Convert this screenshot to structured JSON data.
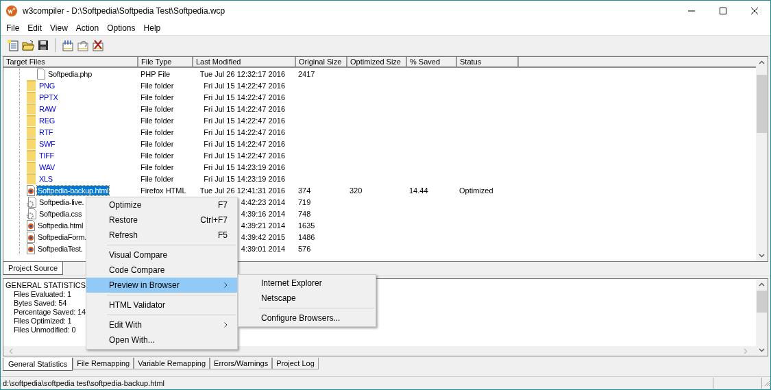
{
  "window": {
    "title": "w3compiler - D:\\Softpedia\\Softpedia Test\\Softpedia.wcp"
  },
  "menu_bar": [
    "File",
    "Edit",
    "View",
    "Action",
    "Options",
    "Help"
  ],
  "toolbar": [
    {
      "kind": "new"
    },
    {
      "kind": "open"
    },
    {
      "kind": "save"
    },
    {
      "kind": "separator"
    },
    {
      "kind": "optimize"
    },
    {
      "kind": "restore"
    },
    {
      "kind": "delete"
    }
  ],
  "file_list": {
    "columns": [
      "Target Files",
      "File Type",
      "Last Modified",
      "Original Size",
      "Optimized Size",
      "% Saved",
      "Status"
    ],
    "rows": [
      {
        "kind": "file",
        "name": "Softpedia.php",
        "type": "PHP File",
        "modified": "Tue Jul 26 12:32:17 2016",
        "original": "2417",
        "selected": false
      },
      {
        "kind": "folder",
        "name": "PNG",
        "type": "File folder",
        "modified": "Fri Jul 15 14:22:47 2016",
        "selected": false
      },
      {
        "kind": "folder",
        "name": "PPTX",
        "type": "File folder",
        "modified": "Fri Jul 15 14:22:47 2016",
        "selected": false
      },
      {
        "kind": "folder",
        "name": "RAW",
        "type": "File folder",
        "modified": "Fri Jul 15 14:22:47 2016",
        "selected": false
      },
      {
        "kind": "folder",
        "name": "REG",
        "type": "File folder",
        "modified": "Fri Jul 15 14:22:47 2016",
        "selected": false
      },
      {
        "kind": "folder",
        "name": "RTF",
        "type": "File folder",
        "modified": "Fri Jul 15 14:22:47 2016",
        "selected": false
      },
      {
        "kind": "folder",
        "name": "SWF",
        "type": "File folder",
        "modified": "Fri Jul 15 14:22:47 2016",
        "selected": false
      },
      {
        "kind": "folder",
        "name": "TIFF",
        "type": "File folder",
        "modified": "Fri Jul 15 14:22:47 2016",
        "selected": false
      },
      {
        "kind": "folder",
        "name": "WAV",
        "type": "File folder",
        "modified": "Fri Jul 15 14:23:19 2016",
        "selected": false
      },
      {
        "kind": "folder",
        "name": "XLS",
        "type": "File folder",
        "modified": "Fri Jul 15 14:23:19 2016",
        "selected": false
      },
      {
        "kind": "html",
        "name": "Softpedia-backup.html",
        "type": "Firefox HTML",
        "modified": "Tue Jul 26 12:41:31 2016",
        "original": "374",
        "optimized": "320",
        "saved": "14.44",
        "status": "Optimized",
        "selected": true
      },
      {
        "kind": "css",
        "name": "Softpedia-live.",
        "modified": "4:42:23 2014",
        "original": "719",
        "selected": false
      },
      {
        "kind": "css",
        "name": "Softpedia.css",
        "modified": "4:39:16 2014",
        "original": "748",
        "selected": false
      },
      {
        "kind": "html",
        "name": "Softpedia.html",
        "modified": "4:39:21 2014",
        "original": "1635",
        "selected": false
      },
      {
        "kind": "html",
        "name": "SoftpediaForm.",
        "modified": "4:39:42 2015",
        "original": "1486",
        "selected": false
      },
      {
        "kind": "html",
        "name": "SoftpediaTest.",
        "modified": "4:39:01 2014",
        "original": "576",
        "selected": false
      }
    ]
  },
  "top_tabs": [
    {
      "label": "Project Source",
      "selected": true
    }
  ],
  "statistics": {
    "heading": "GENERAL STATISTICS",
    "lines": [
      "Files Evaluated: 1",
      "Bytes Saved: 54",
      "Percentage Saved: 14",
      "Files Optimized: 1",
      "Files Unmodified: 0"
    ]
  },
  "bottom_tabs": [
    {
      "label": "General Statistics",
      "selected": true
    },
    {
      "label": "File Remapping",
      "selected": false
    },
    {
      "label": "Variable Remapping",
      "selected": false
    },
    {
      "label": "Errors/Warnings",
      "selected": false
    },
    {
      "label": "Project Log",
      "selected": false
    }
  ],
  "status_bar": "d:\\softpedia\\softpedia test\\softpedia-backup.html",
  "context_menu": [
    {
      "kind": "item",
      "label": "Optimize",
      "shortcut": "F7",
      "submenu": false,
      "selected": false
    },
    {
      "kind": "item",
      "label": "Restore",
      "shortcut": "Ctrl+F7",
      "submenu": false,
      "selected": false
    },
    {
      "kind": "item",
      "label": "Refresh",
      "shortcut": "F5",
      "submenu": false,
      "selected": false
    },
    {
      "kind": "separator"
    },
    {
      "kind": "item",
      "label": "Visual Compare",
      "submenu": false,
      "selected": false
    },
    {
      "kind": "item",
      "label": "Code Compare",
      "submenu": false,
      "selected": false
    },
    {
      "kind": "item",
      "label": "Preview in Browser",
      "submenu": true,
      "selected": true
    },
    {
      "kind": "separator"
    },
    {
      "kind": "item",
      "label": "HTML Validator",
      "submenu": false,
      "selected": false
    },
    {
      "kind": "separator"
    },
    {
      "kind": "item",
      "label": "Edit With",
      "submenu": true,
      "selected": false
    },
    {
      "kind": "item",
      "label": "Open With...",
      "submenu": false,
      "selected": false
    }
  ],
  "submenu": [
    {
      "kind": "item",
      "label": "Internet Explorer"
    },
    {
      "kind": "item",
      "label": "Netscape"
    },
    {
      "kind": "separator"
    },
    {
      "kind": "item",
      "label": "Configure Browsers..."
    }
  ]
}
